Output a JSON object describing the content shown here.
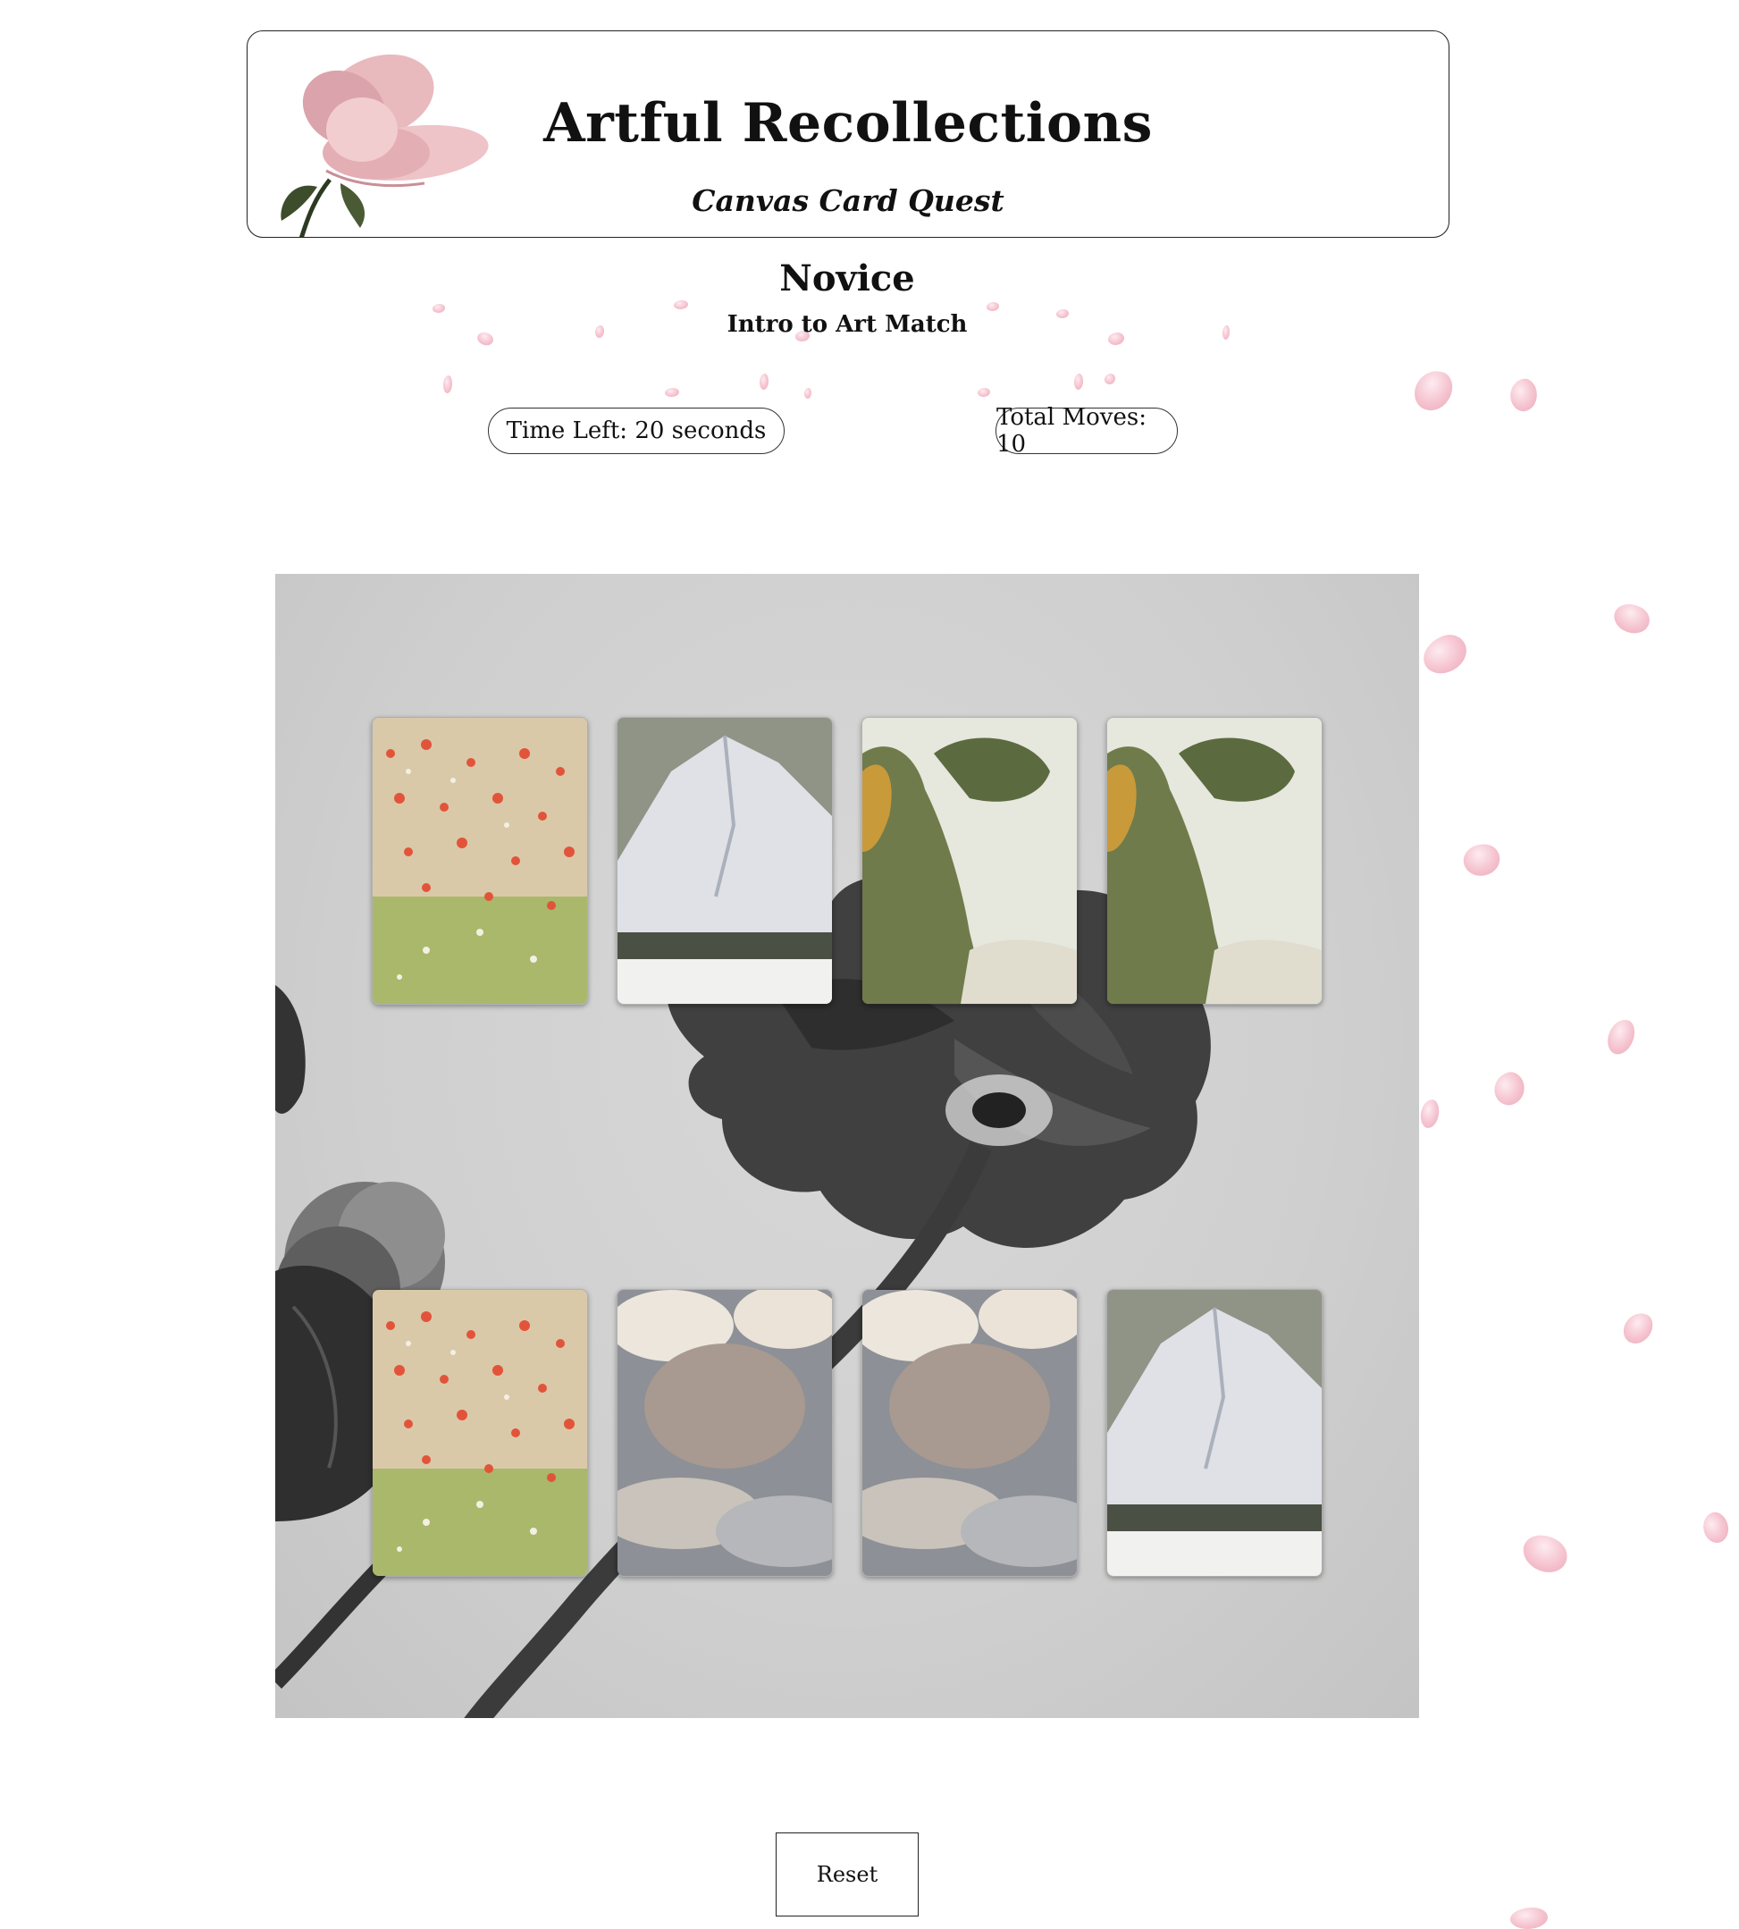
{
  "header": {
    "title": "Artful Recollections",
    "subtitle": "Canvas Card Quest"
  },
  "level": {
    "name": "Novice",
    "description": "Intro to Art Match"
  },
  "stats": {
    "time_left": "Time Left: 20 seconds",
    "total_moves": "Total Moves: 10"
  },
  "board": {
    "cards": [
      {
        "art": "poppy-field"
      },
      {
        "art": "snowy-mountain"
      },
      {
        "art": "forest-cliff"
      },
      {
        "art": "forest-cliff"
      },
      {
        "art": "poppy-field"
      },
      {
        "art": "cloudy-sky"
      },
      {
        "art": "cloudy-sky"
      },
      {
        "art": "snowy-mountain"
      }
    ]
  },
  "controls": {
    "reset_label": "Reset"
  }
}
